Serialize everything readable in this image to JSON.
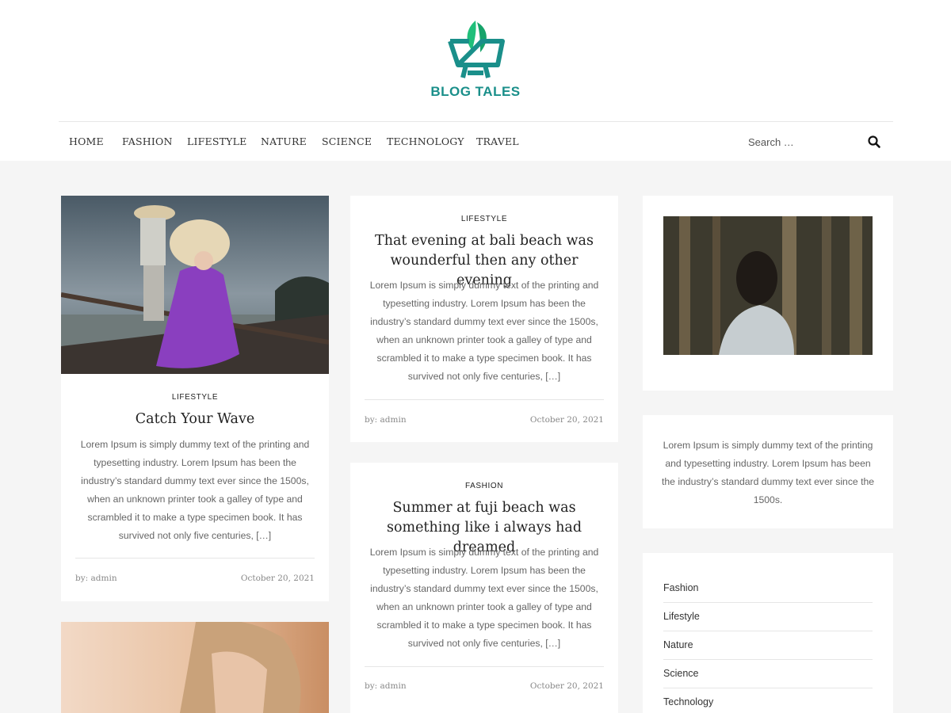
{
  "brand": {
    "name": "BLOG TALES",
    "color": "#1a8f8a",
    "accent": "#1fbf7a"
  },
  "nav": {
    "items": [
      "HOME",
      "FASHION",
      "LIFESTYLE",
      "NATURE",
      "SCIENCE",
      "TECHNOLOGY",
      "TRAVEL"
    ],
    "search_placeholder": "Search …",
    "search_icon": "search-icon"
  },
  "posts": [
    {
      "category": "LIFESTYLE",
      "title": "Catch Your Wave",
      "excerpt": "Lorem Ipsum is simply dummy text of the printing and typesetting industry. Lorem Ipsum has been the industry’s standard dummy text ever since the 1500s, when an unknown printer took a galley of type and scrambled it to make a type specimen book. It has survived not only five centuries, […]",
      "author": "by: admin",
      "date": "October 20, 2021"
    },
    {
      "category": "LIFESTYLE",
      "title": "That evening at bali beach was wounderful then any other evening",
      "excerpt": "Lorem Ipsum is simply dummy text of the printing and typesetting industry. Lorem Ipsum has been the industry’s standard dummy text ever since the 1500s, when an unknown printer took a galley of type and scrambled it to make a type specimen book. It has survived not only five centuries, […]",
      "author": "by: admin",
      "date": "October 20, 2021"
    },
    {
      "category": "FASHION",
      "title": "Summer at fuji beach was something like i always had dreamed",
      "excerpt": "Lorem Ipsum is simply dummy text of the printing and typesetting industry. Lorem Ipsum has been the industry’s standard dummy text ever since the 1500s, when an unknown printer took a galley of type and scrambled it to make a type specimen book. It has survived not only five centuries, […]",
      "author": "by: admin",
      "date": "October 20, 2021"
    }
  ],
  "sidebar": {
    "about_text": "Lorem Ipsum is simply dummy text of the printing and typesetting industry. Lorem Ipsum has been the industry’s standard dummy text ever since the 1500s.",
    "categories": [
      "Fashion",
      "Lifestyle",
      "Nature",
      "Science",
      "Technology"
    ]
  }
}
